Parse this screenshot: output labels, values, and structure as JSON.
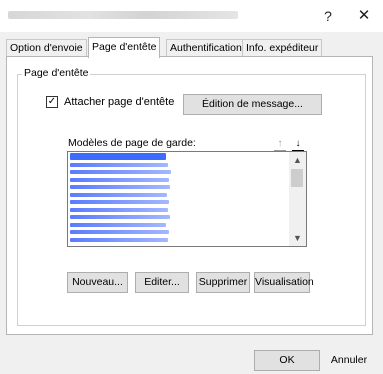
{
  "window": {
    "help_glyph": "?",
    "close_glyph": "✕"
  },
  "tabs": [
    {
      "label": "Option d'envoie",
      "active": false
    },
    {
      "label": "Page d'entête",
      "active": true
    },
    {
      "label": "Authentification",
      "active": false
    },
    {
      "label": "Info. expéditeur",
      "active": false
    }
  ],
  "group": {
    "title": "Page d'entête",
    "attach_checkbox": {
      "label": "Attacher page d'entête",
      "checked": true,
      "check_glyph": "✓"
    },
    "edit_message_button": "Édition de message...",
    "list_label": "Modèles de page de garde:",
    "move_up_glyph": "↑",
    "move_down_glyph": "↓",
    "scroll_up_glyph": "▲",
    "scroll_down_glyph": "▼",
    "templates": [
      {
        "selected": true
      },
      {
        "selected": false
      },
      {
        "selected": false
      },
      {
        "selected": false
      },
      {
        "selected": false
      },
      {
        "selected": false
      },
      {
        "selected": false
      },
      {
        "selected": false
      },
      {
        "selected": false
      },
      {
        "selected": false
      },
      {
        "selected": false
      },
      {
        "selected": false
      }
    ],
    "buttons": {
      "new": "Nouveau...",
      "edit": "Editer...",
      "delete": "Supprimer",
      "preview": "Visualisation"
    }
  },
  "footer": {
    "ok": "OK",
    "cancel": "Annuler"
  }
}
